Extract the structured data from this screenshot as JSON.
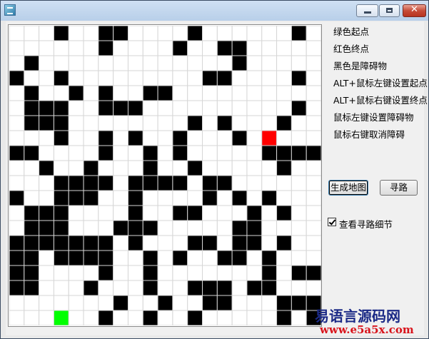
{
  "window": {
    "title": ""
  },
  "grid": {
    "rows": 20,
    "cols": 21,
    "cells": [
      "000100110000100000010",
      "000000100001001100000",
      "010000000000000100000",
      "100100000000011000010",
      "010010100110000000000",
      "011100111000000000010",
      "011100000000101000100",
      "000100101001000100000",
      "110000100101000001111",
      "001001000100100000100",
      "000111101111011000000",
      "100111001000010101000",
      "011100001001100010100",
      "011100011100000110000",
      "111111101000110110100",
      "110111100101001101000",
      "110000100100000001011",
      "110001000100111011000",
      "000000010010011000111",
      "000000100100100000101"
    ],
    "start": {
      "row": 19,
      "col": 3
    },
    "end": {
      "row": 7,
      "col": 17
    },
    "colors": {
      "wall": "#000000",
      "start": "#00ff00",
      "end": "#ff0000",
      "empty": "#ffffff",
      "line": "#d6d6d6"
    }
  },
  "legend": [
    "绿色起点",
    "红色终点",
    "黑色是障碍物",
    "ALT+鼠标左键设置起点",
    "ALT+鼠标右键设置终点",
    "鼠标左键设置障碍物",
    "鼠标右键取消障碍"
  ],
  "buttons": {
    "generate_map": "生成地图",
    "find_path": "寻路"
  },
  "checkbox": {
    "label": "查看寻路细节",
    "checked": true
  },
  "watermark": {
    "line1": "易语言源码网",
    "line2": "www.e5a5x.com"
  }
}
